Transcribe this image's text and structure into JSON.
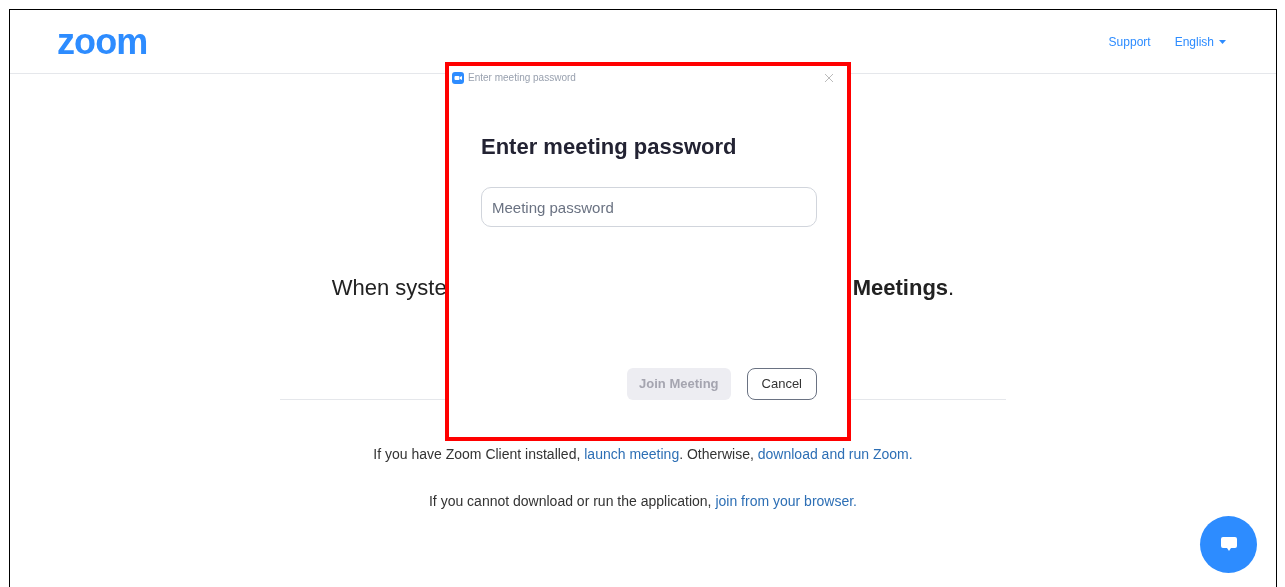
{
  "header": {
    "logo": "zoom",
    "links": [
      {
        "label": "Support"
      },
      {
        "label": "English"
      }
    ]
  },
  "prompt": {
    "left": "When syste",
    "right": "**Meetings**."
  },
  "info_lines": [
    [
      {
        "kind": "text",
        "text": "If you have Zoom Client installed, "
      },
      {
        "kind": "link",
        "text": "launch meeting"
      },
      {
        "kind": "text",
        "text": ". Otherwise, "
      },
      {
        "kind": "link",
        "text": "download and run Zoom."
      }
    ],
    [
      {
        "kind": "text",
        "text": "If you cannot download or run the application, "
      },
      {
        "kind": "link",
        "text": "join from your browser."
      }
    ]
  ],
  "dialog": {
    "title": "Enter meeting password",
    "heading": "Enter meeting password",
    "password_field": {
      "placeholder": "Meeting password"
    },
    "buttons": [
      {
        "label": "Join Meeting",
        "disabled": true
      },
      {
        "label": "Cancel",
        "disabled": false
      }
    ]
  }
}
